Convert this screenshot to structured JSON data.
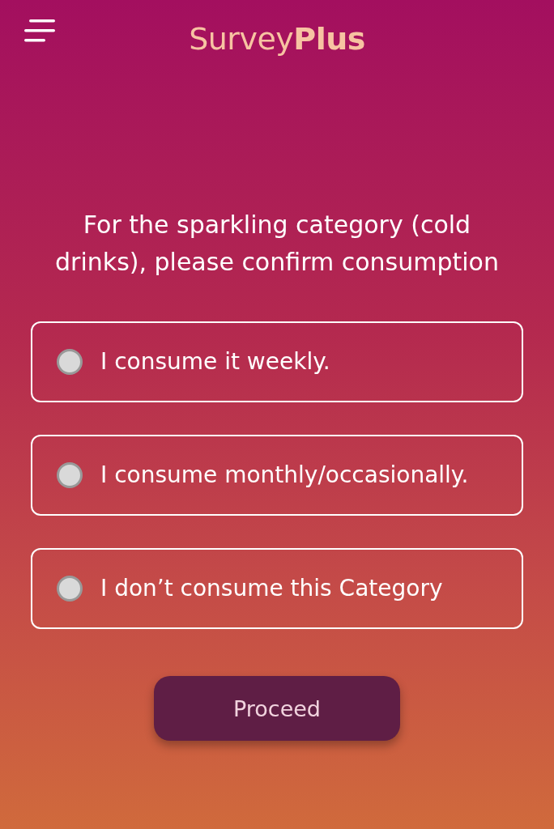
{
  "header": {
    "title": "Survey**Plus**"
  },
  "question": "For the sparkling category (cold drinks), please confirm consumption",
  "options": [
    {
      "label": "I consume it weekly.",
      "selected": false
    },
    {
      "label": "I consume monthly/occasionally.",
      "selected": false
    },
    {
      "label": "I don’t consume this Category",
      "selected": false
    }
  ],
  "button": "Proceed"
}
